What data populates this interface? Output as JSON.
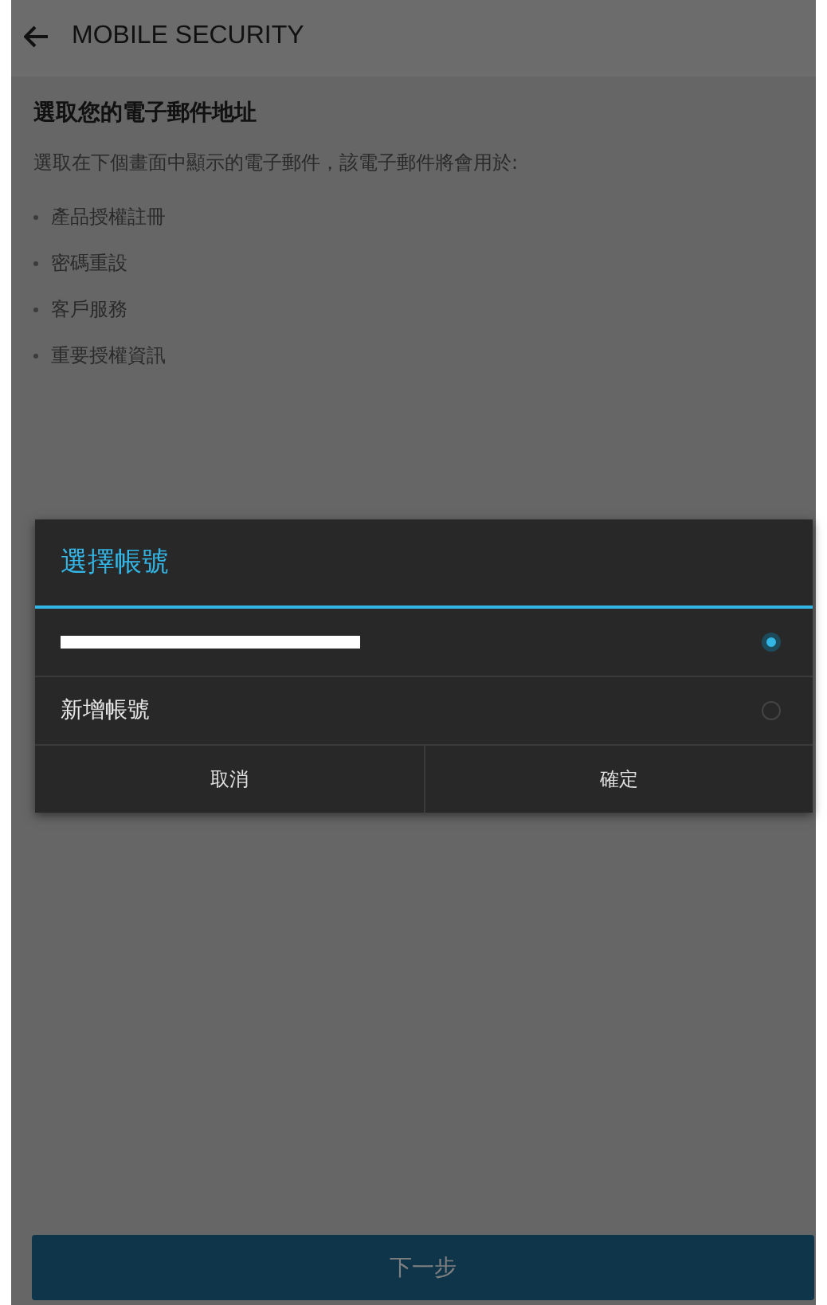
{
  "app_bar": {
    "title": "MOBILE SECURITY"
  },
  "heading": "選取您的電子郵件地址",
  "description": "選取在下個畫面中顯示的電子郵件，該電子郵件將會用於:",
  "bullets": [
    "產品授權註冊",
    "密碼重設",
    "客戶服務",
    "重要授權資訊"
  ],
  "next_button": {
    "label": "下一步",
    "disabled": true
  },
  "dialog": {
    "title": "選擇帳號",
    "options": [
      {
        "kind": "redacted",
        "selected": true
      },
      {
        "kind": "account",
        "label": "新增帳號",
        "selected": false
      }
    ],
    "buttons": [
      "取消",
      "確定"
    ]
  }
}
